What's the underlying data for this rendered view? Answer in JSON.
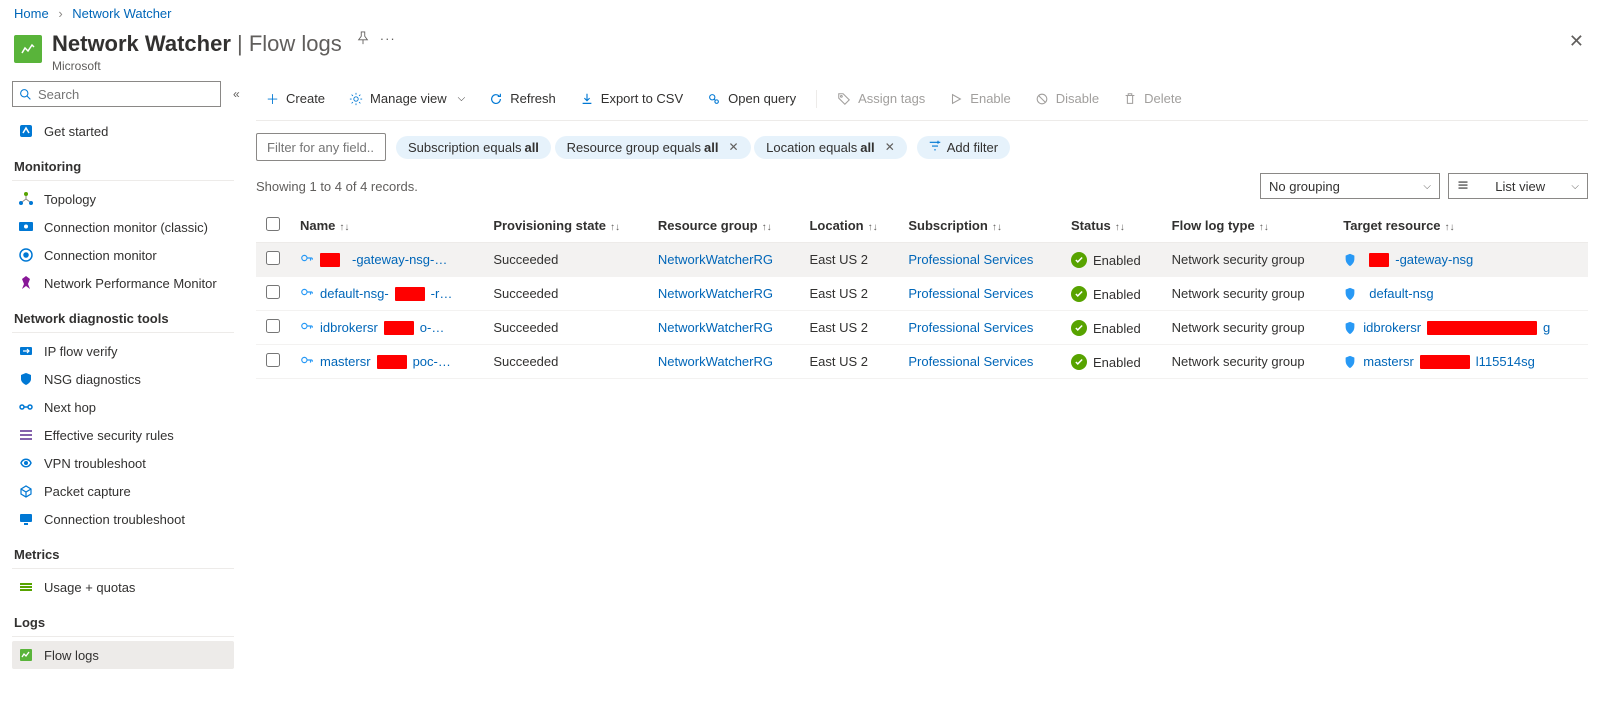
{
  "breadcrumb": {
    "home": "Home",
    "parent": "Network Watcher"
  },
  "header": {
    "title": "Network Watcher",
    "subtitle": "Flow logs",
    "company": "Microsoft"
  },
  "sidebar": {
    "search_placeholder": "Search",
    "top": [
      {
        "id": "get-started",
        "label": "Get started"
      }
    ],
    "groups": [
      {
        "title": "Monitoring",
        "items": [
          {
            "id": "topology",
            "label": "Topology"
          },
          {
            "id": "conn-mon-classic",
            "label": "Connection monitor (classic)"
          },
          {
            "id": "conn-mon",
            "label": "Connection monitor"
          },
          {
            "id": "npm",
            "label": "Network Performance Monitor"
          }
        ]
      },
      {
        "title": "Network diagnostic tools",
        "items": [
          {
            "id": "ip-flow",
            "label": "IP flow verify"
          },
          {
            "id": "nsg-diag",
            "label": "NSG diagnostics"
          },
          {
            "id": "next-hop",
            "label": "Next hop"
          },
          {
            "id": "eff-sec",
            "label": "Effective security rules"
          },
          {
            "id": "vpn-ts",
            "label": "VPN troubleshoot"
          },
          {
            "id": "pkt-cap",
            "label": "Packet capture"
          },
          {
            "id": "conn-ts",
            "label": "Connection troubleshoot"
          }
        ]
      },
      {
        "title": "Metrics",
        "items": [
          {
            "id": "usage",
            "label": "Usage + quotas"
          }
        ]
      },
      {
        "title": "Logs",
        "items": [
          {
            "id": "flow-logs",
            "label": "Flow logs",
            "active": true
          }
        ]
      }
    ]
  },
  "toolbar": {
    "create": "Create",
    "manage_view": "Manage view",
    "refresh": "Refresh",
    "export_csv": "Export to CSV",
    "open_query": "Open query",
    "assign_tags": "Assign tags",
    "enable": "Enable",
    "disable": "Disable",
    "delete": "Delete"
  },
  "filters": {
    "filter_placeholder": "Filter for any field...",
    "pills": [
      {
        "prefix": "Subscription equals ",
        "bold": "all",
        "close": false
      },
      {
        "prefix": "Resource group equals ",
        "bold": "all",
        "close": true
      },
      {
        "prefix": "Location equals ",
        "bold": "all",
        "close": true
      }
    ],
    "add_filter": "Add filter"
  },
  "info": {
    "showing": "Showing 1 to 4 of 4 records.",
    "grouping": "No grouping",
    "view": "List view"
  },
  "columns": {
    "name": "Name",
    "prov": "Provisioning state",
    "rg": "Resource group",
    "loc": "Location",
    "sub": "Subscription",
    "status": "Status",
    "type": "Flow log type",
    "target": "Target resource"
  },
  "rows": [
    {
      "name_pre": "",
      "name_post": "-gateway-nsg-…",
      "prov": "Succeeded",
      "rg": "NetworkWatcherRG",
      "loc": "East US 2",
      "sub": "Professional Services",
      "status": "Enabled",
      "type": "Network security group",
      "target_pre": "",
      "target_post": "-gateway-nsg",
      "redact_name": true,
      "redact_target": true
    },
    {
      "name_pre": "default-nsg-",
      "name_post": "-r…",
      "prov": "Succeeded",
      "rg": "NetworkWatcherRG",
      "loc": "East US 2",
      "sub": "Professional Services",
      "status": "Enabled",
      "type": "Network security group",
      "target_pre": "",
      "target_post": "default-nsg",
      "redact_name": true,
      "redact_target": false
    },
    {
      "name_pre": "idbrokersr",
      "name_post": "o-…",
      "prov": "Succeeded",
      "rg": "NetworkWatcherRG",
      "loc": "East US 2",
      "sub": "Professional Services",
      "status": "Enabled",
      "type": "Network security group",
      "target_pre": "idbrokersr",
      "target_post": "g",
      "redact_name": true,
      "redact_target": true,
      "target_wide": true
    },
    {
      "name_pre": "mastersr",
      "name_post": "poc-…",
      "prov": "Succeeded",
      "rg": "NetworkWatcherRG",
      "loc": "East US 2",
      "sub": "Professional Services",
      "status": "Enabled",
      "type": "Network security group",
      "target_pre": "mastersr",
      "target_post": "l115514sg",
      "redact_name": true,
      "redact_target": true
    }
  ]
}
